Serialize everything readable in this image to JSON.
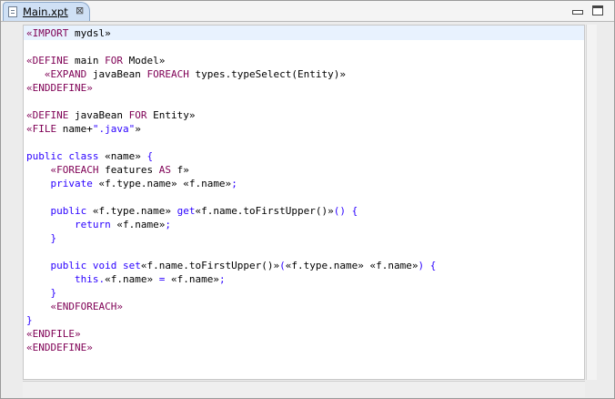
{
  "tab": {
    "title": "Main.xpt",
    "close": "⊠",
    "icon": "file-icon"
  },
  "controls": {
    "minimize": "minimize-icon",
    "maximize": "maximize-icon"
  },
  "code_lines": [
    [
      {
        "t": "«IMPORT",
        "k": "kw"
      },
      {
        "t": " mydsl»",
        "k": "tx"
      }
    ],
    [],
    [
      {
        "t": "«DEFINE",
        "k": "kw"
      },
      {
        "t": " main ",
        "k": "tx"
      },
      {
        "t": "FOR",
        "k": "kw"
      },
      {
        "t": " Model»",
        "k": "tx"
      }
    ],
    [
      {
        "t": "   «EXPAND",
        "k": "kw"
      },
      {
        "t": " javaBean ",
        "k": "tx"
      },
      {
        "t": "FOREACH",
        "k": "kw"
      },
      {
        "t": " types.typeSelect(Entity)»",
        "k": "tx"
      }
    ],
    [
      {
        "t": "«ENDDEFINE»",
        "k": "kw"
      }
    ],
    [],
    [
      {
        "t": "«DEFINE",
        "k": "kw"
      },
      {
        "t": " javaBean ",
        "k": "tx"
      },
      {
        "t": "FOR",
        "k": "kw"
      },
      {
        "t": " Entity»",
        "k": "tx"
      }
    ],
    [
      {
        "t": "«FILE",
        "k": "kw"
      },
      {
        "t": " name+",
        "k": "tx"
      },
      {
        "t": "\".java\"",
        "k": "str"
      },
      {
        "t": "»",
        "k": "tx"
      }
    ],
    [],
    [
      {
        "t": "public class ",
        "k": "str"
      },
      {
        "t": "«name»",
        "k": "tx"
      },
      {
        "t": " {",
        "k": "str"
      }
    ],
    [
      {
        "t": "    «FOREACH",
        "k": "kw"
      },
      {
        "t": " features ",
        "k": "tx"
      },
      {
        "t": "AS",
        "k": "kw"
      },
      {
        "t": " f»",
        "k": "tx"
      }
    ],
    [
      {
        "t": "    private ",
        "k": "str"
      },
      {
        "t": "«f.type.name» «f.name»",
        "k": "tx"
      },
      {
        "t": ";",
        "k": "str"
      }
    ],
    [],
    [
      {
        "t": "    public ",
        "k": "str"
      },
      {
        "t": "«f.type.name»",
        "k": "tx"
      },
      {
        "t": " get",
        "k": "str"
      },
      {
        "t": "«f.name.toFirstUpper()»",
        "k": "tx"
      },
      {
        "t": "() {",
        "k": "str"
      }
    ],
    [
      {
        "t": "        return ",
        "k": "str"
      },
      {
        "t": "«f.name»",
        "k": "tx"
      },
      {
        "t": ";",
        "k": "str"
      }
    ],
    [
      {
        "t": "    }",
        "k": "str"
      }
    ],
    [],
    [
      {
        "t": "    public void set",
        "k": "str"
      },
      {
        "t": "«f.name.toFirstUpper()»",
        "k": "tx"
      },
      {
        "t": "(",
        "k": "str"
      },
      {
        "t": "«f.type.name» «f.name»",
        "k": "tx"
      },
      {
        "t": ") {",
        "k": "str"
      }
    ],
    [
      {
        "t": "        this.",
        "k": "str"
      },
      {
        "t": "«f.name»",
        "k": "tx"
      },
      {
        "t": " = ",
        "k": "str"
      },
      {
        "t": "«f.name»",
        "k": "tx"
      },
      {
        "t": ";",
        "k": "str"
      }
    ],
    [
      {
        "t": "    }",
        "k": "str"
      }
    ],
    [
      {
        "t": "    «ENDFOREACH»",
        "k": "kw"
      }
    ],
    [
      {
        "t": "}",
        "k": "str"
      }
    ],
    [
      {
        "t": "«ENDFILE»",
        "k": "kw"
      }
    ],
    [
      {
        "t": "«ENDDEFINE»",
        "k": "kw"
      }
    ]
  ]
}
